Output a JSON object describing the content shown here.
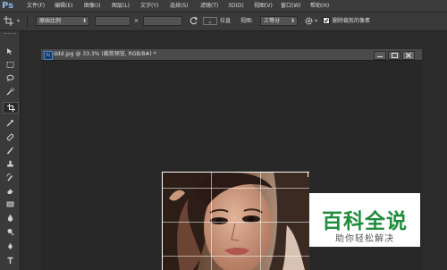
{
  "app": {
    "logo": "Ps"
  },
  "menu": [
    "文件(F)",
    "编辑(E)",
    "图像(I)",
    "图层(L)",
    "文字(Y)",
    "选择(S)",
    "滤镜(T)",
    "3D(D)",
    "视图(V)",
    "窗口(W)",
    "帮助(H)"
  ],
  "options_bar": {
    "ratio_select": "原始比例",
    "width_value": "",
    "times_sign": "×",
    "height_value": "",
    "straighten_label": "拉直",
    "view_label": "视图:",
    "view_select": "三等分",
    "delete_cropped_label": "删除裁剪的像素",
    "delete_cropped_checked": true
  },
  "document": {
    "badge": "Ps",
    "title": "ddd.jpg @ 33.3% (裁剪预览, RGB/8#) *"
  },
  "watermark": {
    "title": "百科全说",
    "subtitle": "助你轻松解决"
  },
  "colors": {
    "watermark_green": "#1e8c3b",
    "ps_blue": "#4f84c4"
  },
  "tools": [
    "move-tool",
    "marquee-tool",
    "lasso-tool",
    "quick-select-tool",
    "crop-tool",
    "eyedropper-tool",
    "healing-brush-tool",
    "brush-tool",
    "clone-stamp-tool",
    "history-brush-tool",
    "eraser-tool",
    "gradient-tool",
    "blur-tool",
    "dodge-tool",
    "pen-tool",
    "type-tool"
  ]
}
